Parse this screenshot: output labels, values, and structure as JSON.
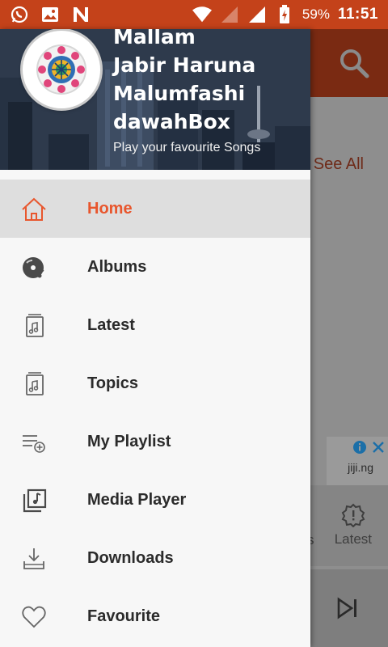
{
  "status_bar": {
    "battery": "59%",
    "time": "11:51",
    "icons": [
      "whatsapp-icon",
      "gallery-icon",
      "n-app-icon",
      "wifi-icon",
      "signal-empty-icon",
      "signal-icon",
      "battery-icon"
    ]
  },
  "drawer": {
    "header": {
      "title_lines": [
        "Mallam",
        "Jabir Haruna",
        "Malumfashi",
        "dawahBox"
      ],
      "subtitle": "Play your favourite Songs"
    },
    "menu": [
      {
        "label": "Home",
        "icon": "home-icon",
        "active": true
      },
      {
        "label": "Albums",
        "icon": "album-disc-icon",
        "active": false
      },
      {
        "label": "Latest",
        "icon": "music-file-icon",
        "active": false
      },
      {
        "label": "Topics",
        "icon": "music-file-icon",
        "active": false
      },
      {
        "label": "My Playlist",
        "icon": "playlist-add-icon",
        "active": false
      },
      {
        "label": "Media Player",
        "icon": "music-library-icon",
        "active": false
      },
      {
        "label": "Downloads",
        "icon": "download-icon",
        "active": false
      },
      {
        "label": "Favourite",
        "icon": "heart-icon",
        "active": false
      }
    ]
  },
  "background_app": {
    "see_all": "See All",
    "ad_text": "jiji.ng",
    "tab_latest": "Latest",
    "tab_cut_text": "s"
  },
  "colors": {
    "status_bar": "#c4421a",
    "accent": "#e8562d",
    "active_row": "#dedede"
  }
}
